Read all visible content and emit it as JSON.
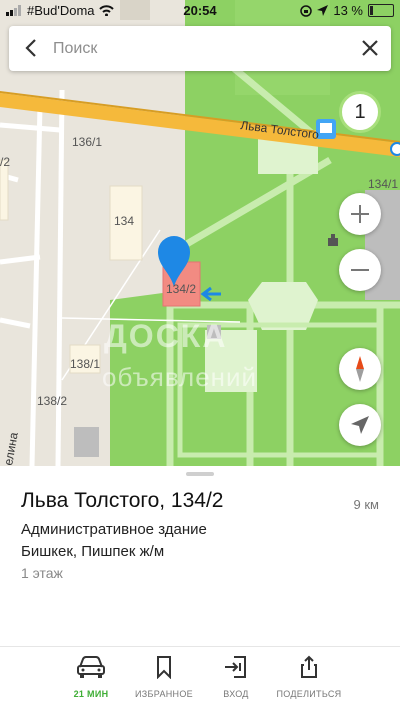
{
  "status_bar": {
    "carrier": "#Bud'Doma",
    "time": "20:54",
    "battery": "13 %",
    "battery_level": 0.13
  },
  "search": {
    "placeholder": "Поиск",
    "value": ""
  },
  "map": {
    "street_label": "Льва Толстого",
    "street_label_left": "елина",
    "zoom_badge": "1",
    "buildings": {
      "b136_1": "136/1",
      "b134": "134",
      "b134_2": "134/2",
      "b138_1": "138/1",
      "b138_2": "138/2",
      "b134_1": "134/1",
      "b2_left": "/2"
    },
    "watermark_top": "ДОСКА",
    "watermark_bottom": "объявлений",
    "colors": {
      "road": "#f5b93b",
      "park": "#8dd163",
      "pin": "#1e88e5",
      "selected_building": "#f28b82",
      "land": "#e9e5dc"
    }
  },
  "place": {
    "title": "Льва Толстого, 134/2",
    "distance": "9 км",
    "type": "Административное здание",
    "address": "Бишкек, Пишпек ж/м",
    "floors": "1 этаж"
  },
  "tabs": [
    {
      "label": "21 МИН",
      "icon": "car-icon",
      "active": true
    },
    {
      "label": "ИЗБРАННОЕ",
      "icon": "bookmark-icon",
      "active": false
    },
    {
      "label": "ВХОД",
      "icon": "entrance-icon",
      "active": false
    },
    {
      "label": "ПОДЕЛИТЬСЯ",
      "icon": "share-icon",
      "active": false
    }
  ],
  "accent_color": "#3fae36"
}
